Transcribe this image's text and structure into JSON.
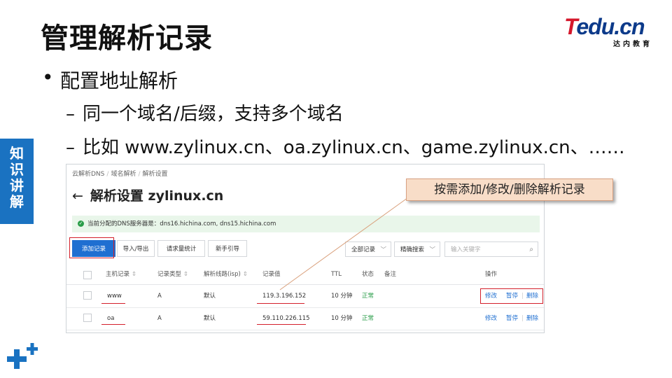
{
  "slide": {
    "title": "管理解析记录",
    "logo": {
      "brand": "Tedu.cn",
      "brand_t": "T",
      "brand_rest": "edu.cn",
      "subtitle": "达内教育"
    },
    "side_tag": [
      "知",
      "识",
      "讲",
      "解"
    ],
    "bullet": "•",
    "bullet_main": "配置地址解析",
    "dash": "–",
    "sub_bullets": [
      "同一个域名/后缀，支持多个域名",
      "比如 www.zylinux.cn、oa.zylinux.cn、game.zylinux.cn、……"
    ],
    "callout": "按需添加/修改/删除解析记录",
    "colors": {
      "accent_blue": "#1a72c1",
      "callout_bg": "#f8ddc8",
      "highlight_red": "#d3202b"
    }
  },
  "console": {
    "breadcrumb": [
      "云解析DNS",
      "域名解析",
      "解析设置"
    ],
    "breadcrumb_sep": "/",
    "back_icon": "←",
    "page_title": "解析设置 zylinux.cn",
    "notice": "当前分配的DNS服务器是：dns16.hichina.com, dns15.hichina.com",
    "notice_icon": "✓",
    "toolbar": {
      "add_record": "添加记录",
      "import_export": "导入/导出",
      "request_stats": "请求量统计",
      "guide": "新手引导"
    },
    "filter_all": "全部记录",
    "filter_match": "精确搜索",
    "chevron": "﹀",
    "search_placeholder": "输入关键字",
    "search_icon": "⌕",
    "sort_icon": "⇕",
    "columns": {
      "host": "主机记录",
      "type": "记录类型",
      "line": "解析线路(isp)",
      "value": "记录值",
      "ttl": "TTL",
      "status": "状态",
      "remark": "备注",
      "actions": "操作"
    },
    "rows": [
      {
        "host": "www",
        "type": "A",
        "line": "默认",
        "value": "119.3.196.152",
        "ttl": "10 分钟",
        "status": "正常",
        "edit": "修改",
        "pause": "暂停",
        "delete": "删除"
      },
      {
        "host": "oa",
        "type": "A",
        "line": "默认",
        "value": "59.110.226.115",
        "ttl": "10 分钟",
        "status": "正常",
        "edit": "修改",
        "pause": "暂停",
        "delete": "删除"
      }
    ]
  }
}
